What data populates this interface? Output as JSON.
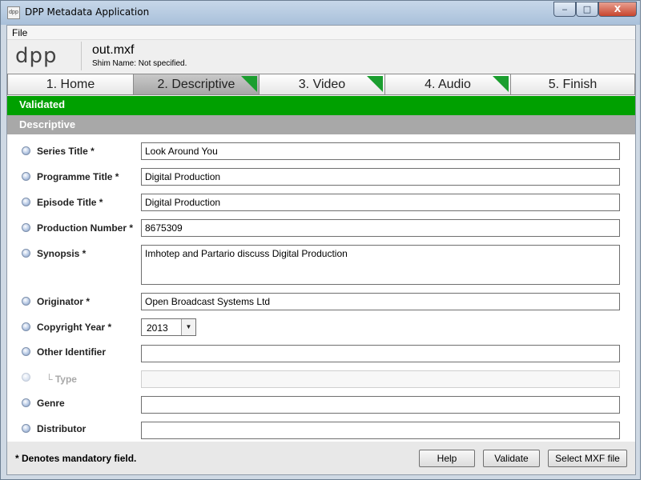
{
  "window": {
    "title": "DPP Metadata Application",
    "app_icon_text": "dpp",
    "min_glyph": "‒",
    "max_glyph": "□",
    "close_glyph": "X"
  },
  "menu": {
    "file": "File"
  },
  "header": {
    "logo": "dpp",
    "filename": "out.mxf",
    "shim": "Shim Name: Not specified."
  },
  "tabs": [
    {
      "label": "1. Home",
      "flag": false
    },
    {
      "label": "2. Descriptive",
      "flag": true,
      "active": true
    },
    {
      "label": "3. Video",
      "flag": true
    },
    {
      "label": "4. Audio",
      "flag": true
    },
    {
      "label": "5. Finish",
      "flag": false
    }
  ],
  "status": {
    "text": "Validated",
    "color": "#00a000"
  },
  "section": {
    "title": "Descriptive"
  },
  "form": {
    "series_title": {
      "label": "Series Title *",
      "value": "Look Around You"
    },
    "programme_title": {
      "label": "Programme Title *",
      "value": "Digital Production"
    },
    "episode_title": {
      "label": "Episode Title *",
      "value": "Digital Production"
    },
    "production_number": {
      "label": "Production Number *",
      "value": "8675309"
    },
    "synopsis": {
      "label": "Synopsis *",
      "value": "Imhotep and Partario discuss Digital Production"
    },
    "originator": {
      "label": "Originator *",
      "value": "Open Broadcast Systems Ltd"
    },
    "copyright_year": {
      "label": "Copyright Year *",
      "value": "2013"
    },
    "other_identifier": {
      "label": "Other Identifier",
      "value": ""
    },
    "type": {
      "label": "└ Type",
      "value": ""
    },
    "genre": {
      "label": "Genre",
      "value": ""
    },
    "distributor": {
      "label": "Distributor",
      "value": ""
    }
  },
  "footer": {
    "note": "* Denotes mandatory field.",
    "help": "Help",
    "validate": "Validate",
    "select_mxf": "Select MXF file"
  }
}
